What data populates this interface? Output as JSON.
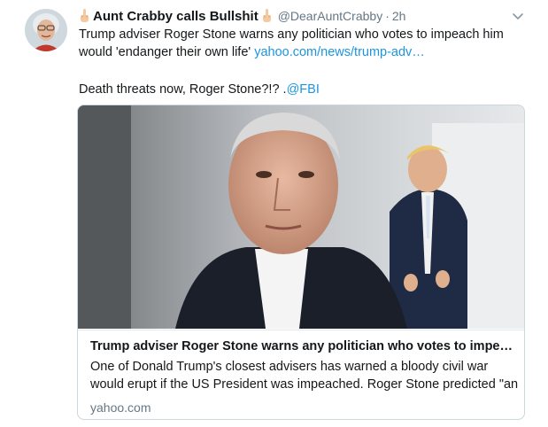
{
  "tweet": {
    "display_name": "Aunt Crabby calls Bullshit",
    "handle": "@DearAuntCrabby",
    "separator": "·",
    "time": "2h",
    "text_line1": "Trump adviser Roger Stone warns any politician who votes to impeach him",
    "text_line2_prefix": "would 'endanger their own life'",
    "text_link": "yahoo.com/news/trump-adv…",
    "text_line3_prefix": "Death threats now, Roger Stone?!? .",
    "mention": "@FBI"
  },
  "card": {
    "title": "Trump adviser Roger Stone warns any politician who votes to impeac...",
    "description_line1": "One of Donald Trump's closest advisers has warned a bloody civil war",
    "description_line2": "would erupt if the US President was impeached. Roger Stone predicted \"an",
    "domain": "yahoo.com"
  },
  "colors": {
    "link": "#1b95e0",
    "secondary_text": "#657786",
    "border": "#ccd6dd"
  },
  "icons": {
    "left_emoji": "middle-finger-icon",
    "right_emoji": "middle-finger-icon",
    "menu": "chevron-down-icon"
  }
}
